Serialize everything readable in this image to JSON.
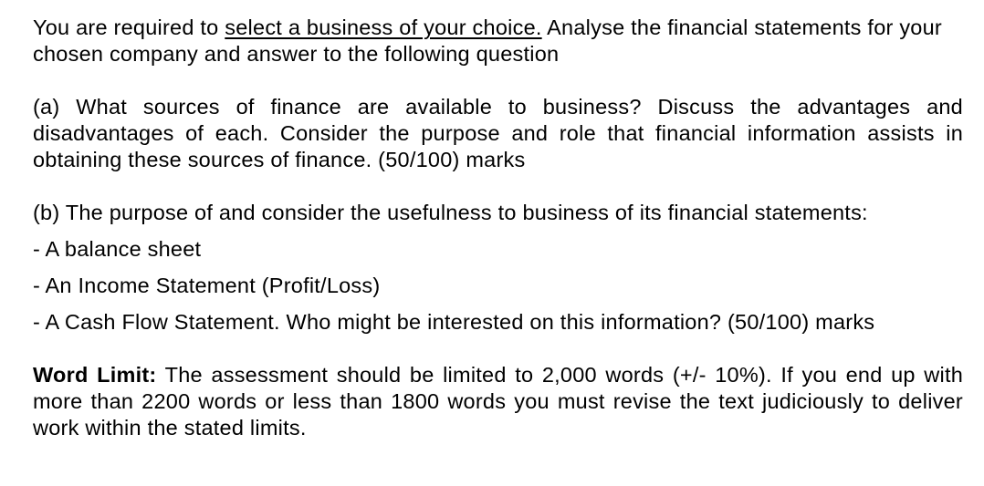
{
  "document": {
    "background_color": "#ffffff",
    "text_color": "#000000",
    "paragraphs": {
      "intro": {
        "lead": "You are required to ",
        "emphasis_underlined": "select a business of your choice.",
        "tail": "  Analyse the financial statements for your chosen company and answer to the following question"
      },
      "question_a": "(a) What sources of finance are available to business? Discuss the advantages and disadvantages of each. Consider the purpose and role that financial information assists in obtaining these sources of finance. (50/100) marks",
      "question_b": "(b) The purpose of and consider the usefulness to business of its financial statements:",
      "bullets": [
        "- A balance sheet",
        "- An Income Statement (Profit/Loss)",
        "- A Cash Flow Statement. Who might be interested on this information? (50/100) marks"
      ],
      "word_limit": {
        "label": "Word Limit:",
        "body": " The assessment should be limited to 2,000 words (+/- 10%). If you end up with more than 2200 words or less than 1800 words you must revise the text judiciously to deliver work within the stated limits."
      }
    }
  }
}
